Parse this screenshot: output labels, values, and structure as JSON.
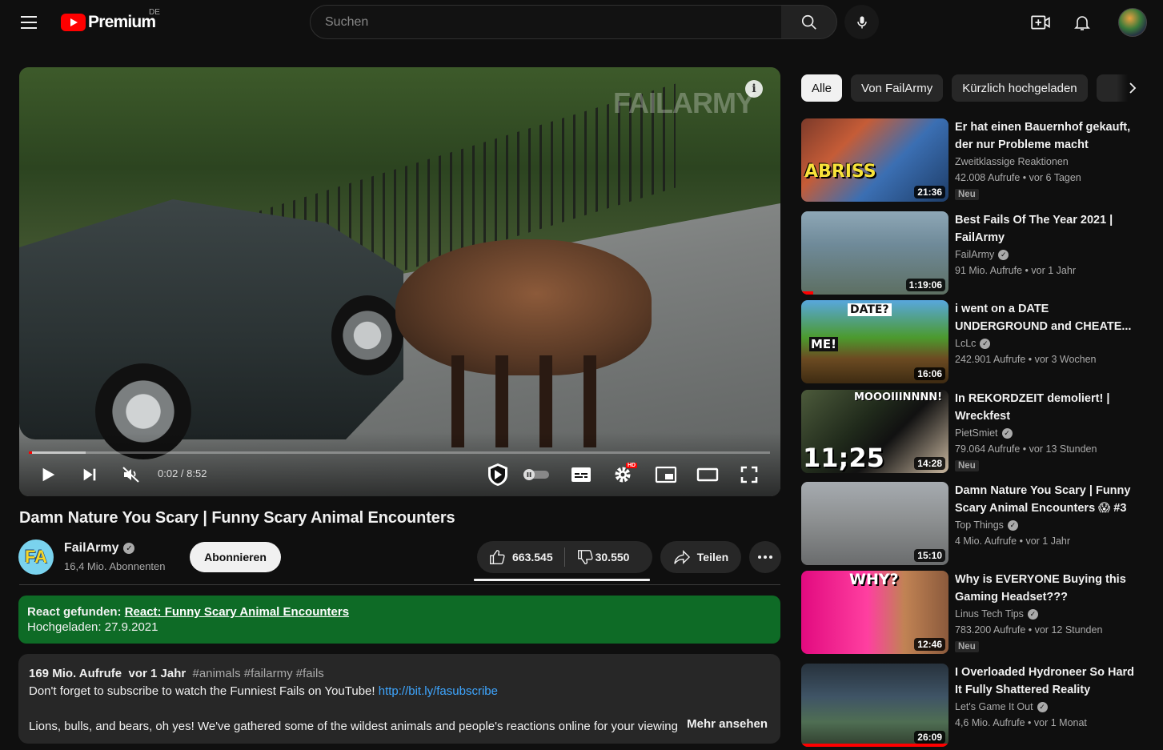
{
  "topbar": {
    "logo_text": "Premium",
    "country": "DE",
    "search_placeholder": "Suchen"
  },
  "player": {
    "watermark": "FAILARMY",
    "time": "0:02 / 8:52",
    "progress_played": 0.004,
    "progress_loaded": 0.077,
    "settings_badge": "HD"
  },
  "video": {
    "title": "Damn Nature You Scary | Funny Scary Animal Encounters",
    "channel": {
      "avatar_text": "FA",
      "name": "FailArmy",
      "subscribers": "16,4 Mio. Abonnenten"
    },
    "subscribe_label": "Abonnieren",
    "likes": "663.545",
    "dislikes": "30.550",
    "share_label": "Teilen"
  },
  "react_box": {
    "prefix": "React gefunden:",
    "link_text": "React: Funny Scary Animal Encounters",
    "uploaded": "Hochgeladen: 27.9.2021"
  },
  "description": {
    "views": "169 Mio. Aufrufe",
    "age": "vor 1 Jahr",
    "tags": "#animals #failarmy #fails",
    "line1": "Don't forget to subscribe to watch the Funniest Fails on YouTube!",
    "link": "http://bit.ly/fasubscribe",
    "line3": "Lions, bulls, and bears, oh yes! We've gathered some of the wildest animals and people's reactions online for your viewing",
    "more_label": "Mehr ansehen"
  },
  "chips": [
    "Alle",
    "Von FailArmy",
    "Kürzlich hochgeladen"
  ],
  "recommendations": [
    {
      "title": "Er hat einen Bauernhof gekauft, der nur Probleme macht",
      "channel": "Zweitklassige Reaktionen",
      "verified": false,
      "views": "42.008 Aufrufe",
      "age": "vor 6 Tagen",
      "badge": "Neu",
      "duration": "21:36",
      "thumb_text": "ABRISS",
      "watched": 0
    },
    {
      "title": "Best Fails Of The Year 2021 | FailArmy",
      "channel": "FailArmy",
      "verified": true,
      "views": "91 Mio. Aufrufe",
      "age": "vor 1 Jahr",
      "badge": "",
      "duration": "1:19:06",
      "thumb_text": "",
      "watched": 0.08
    },
    {
      "title": "i went on a DATE UNDERGROUND and CHEATE...",
      "channel": "LcLc",
      "verified": true,
      "views": "242.901 Aufrufe",
      "age": "vor 3 Wochen",
      "badge": "",
      "duration": "16:06",
      "thumb_text": "DATE?",
      "thumb_text2": "ME!",
      "watched": 0
    },
    {
      "title": "In REKORDZEIT demoliert! | Wreckfest",
      "channel": "PietSmiet",
      "verified": true,
      "views": "79.064 Aufrufe",
      "age": "vor 13 Stunden",
      "badge": "Neu",
      "duration": "14:28",
      "thumb_text": "MOOOIIINNNN!",
      "thumb_text2": "11;25",
      "watched": 0
    },
    {
      "title": "Damn Nature You Scary | Funny Scary Animal Encounters 😱 #3",
      "channel": "Top Things",
      "verified": true,
      "views": "4 Mio. Aufrufe",
      "age": "vor 1 Jahr",
      "badge": "",
      "duration": "15:10",
      "thumb_text": "",
      "watched": 0
    },
    {
      "title": "Why is EVERYONE Buying this Gaming Headset???",
      "channel": "Linus Tech Tips",
      "verified": true,
      "views": "783.200 Aufrufe",
      "age": "vor 12 Stunden",
      "badge": "Neu",
      "duration": "12:46",
      "thumb_text": "WHY?",
      "watched": 0
    },
    {
      "title": "I Overloaded Hydroneer So Hard It Fully Shattered Reality",
      "channel": "Let's Game It Out",
      "verified": true,
      "views": "4,6 Mio. Aufrufe",
      "age": "vor 1 Monat",
      "badge": "",
      "duration": "26:09",
      "thumb_text": "",
      "watched": 1
    }
  ],
  "colors": {
    "background": "#0f0f0f",
    "brand_red": "#ff0000",
    "react_green": "#0e6b26",
    "link_blue": "#3ea6ff"
  },
  "icons": [
    "menu-icon",
    "youtube-logo-icon",
    "search-icon",
    "mic-icon",
    "create-icon",
    "bell-icon",
    "play-icon",
    "next-icon",
    "mute-icon",
    "sponsorblock-icon",
    "autoplay-toggle",
    "subtitles-icon",
    "settings-icon",
    "miniplayer-icon",
    "theater-icon",
    "fullscreen-icon",
    "like-icon",
    "dislike-icon",
    "share-icon",
    "more-icon",
    "chevron-right-icon"
  ]
}
